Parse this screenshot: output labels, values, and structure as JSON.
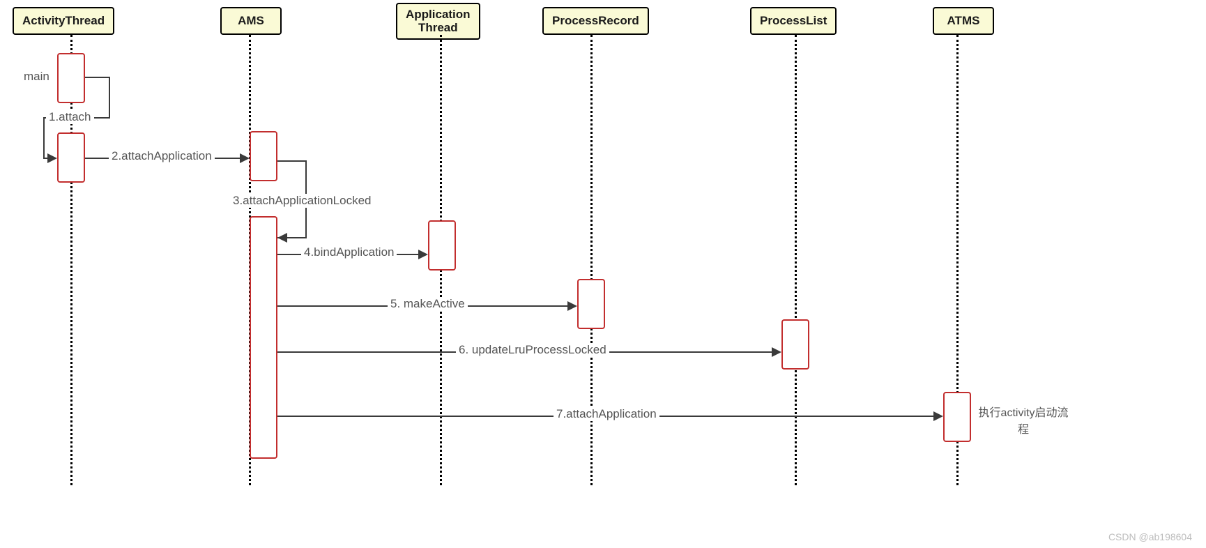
{
  "participants": {
    "activityThread": "ActivityThread",
    "ams": "AMS",
    "applicationThread": "Application Thread",
    "processRecord": "ProcessRecord",
    "processList": "ProcessList",
    "atms": "ATMS"
  },
  "messages": {
    "main": "main",
    "m1": "1.attach",
    "m2": "2.attachApplication",
    "m3": "3.attachApplicationLocked",
    "m4": "4.bindApplication",
    "m5": "5. makeActive",
    "m6": "6. updateLruProcessLocked",
    "m7": "7.attachApplication"
  },
  "note_atms": "执行activity启动流程",
  "watermark": "CSDN @ab198604",
  "chart_data": {
    "type": "sequence-diagram",
    "participants": [
      "ActivityThread",
      "AMS",
      "Application Thread",
      "ProcessRecord",
      "ProcessList",
      "ATMS"
    ],
    "messages": [
      {
        "from": "ActivityThread",
        "to": "ActivityThread",
        "label": "main",
        "kind": "self"
      },
      {
        "from": "ActivityThread",
        "to": "ActivityThread",
        "label": "1.attach",
        "kind": "self"
      },
      {
        "from": "ActivityThread",
        "to": "AMS",
        "label": "2.attachApplication"
      },
      {
        "from": "AMS",
        "to": "AMS",
        "label": "3.attachApplicationLocked",
        "kind": "self"
      },
      {
        "from": "AMS",
        "to": "Application Thread",
        "label": "4.bindApplication"
      },
      {
        "from": "AMS",
        "to": "ProcessRecord",
        "label": "5. makeActive"
      },
      {
        "from": "AMS",
        "to": "ProcessList",
        "label": "6. updateLruProcessLocked"
      },
      {
        "from": "AMS",
        "to": "ATMS",
        "label": "7.attachApplication",
        "note": "执行activity启动流程"
      }
    ]
  }
}
